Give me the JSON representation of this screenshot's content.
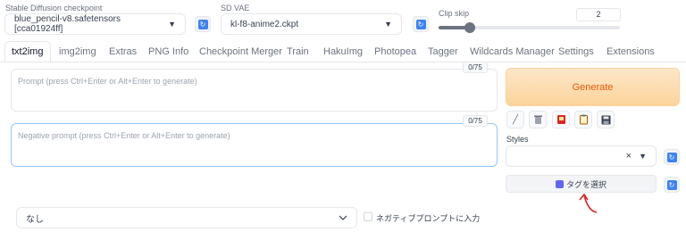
{
  "header": {
    "checkpoint_label": "Stable Diffusion checkpoint",
    "checkpoint_value": "blue_pencil-v8.safetensors [cca01924ff]",
    "vae_label": "SD VAE",
    "vae_value": "kl-f8-anime2.ckpt",
    "clip_label": "Clip skip",
    "clip_value": "2",
    "clip_fraction": 0.17
  },
  "tabs": [
    "txt2img",
    "img2img",
    "Extras",
    "PNG Info",
    "Checkpoint Merger",
    "Train",
    "HakuImg",
    "Photopea",
    "Tagger",
    "Wildcards Manager",
    "Settings",
    "Extensions"
  ],
  "prompt": {
    "placeholder": "Prompt (press Ctrl+Enter or Alt+Enter to generate)",
    "counter": "0/75"
  },
  "negative": {
    "placeholder": "Negative prompt (press Ctrl+Enter or Alt+Enter to generate)",
    "counter": "0/75"
  },
  "generate_label": "Generate",
  "styles": {
    "label": "Styles",
    "clear": "×"
  },
  "tag_button": "タグを選択",
  "bottom": {
    "select_value": "なし",
    "checkbox_label": "ネガティブプロンプトに入力"
  },
  "colors": {
    "generate_bg": "#fde0b8",
    "generate_text": "#ea580c",
    "refresh_icon": "#3b82f6",
    "focus_border": "#93c5fd",
    "annotation_arrow": "#dc2626"
  },
  "icons": [
    "pencil-icon",
    "trash-icon",
    "card-icon",
    "clipboard-icon",
    "save-icon",
    "refresh-icon",
    "chevron-down-icon",
    "arrow-annotation-icon"
  ]
}
